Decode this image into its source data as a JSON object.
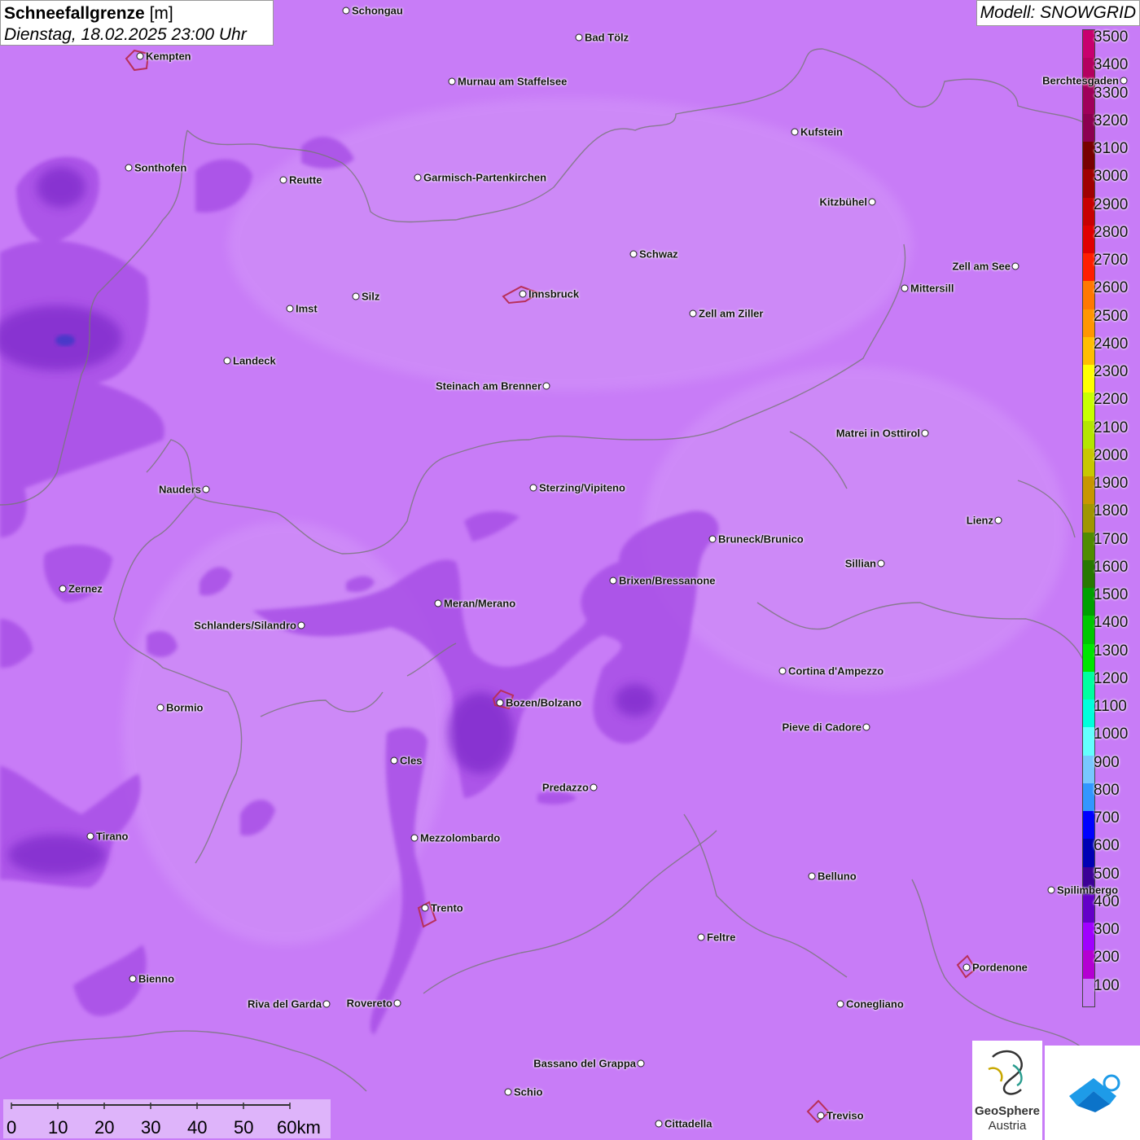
{
  "header": {
    "title_bold": "Schneefallgrenze",
    "title_unit": " [m]",
    "datetime": "Dienstag, 18.02.2025 23:00 Uhr"
  },
  "model_label": "Modell: SNOWGRID",
  "legend": {
    "labels": [
      "3500",
      "3400",
      "3300",
      "3200",
      "3100",
      "3000",
      "2900",
      "2800",
      "2700",
      "2600",
      "2500",
      "2400",
      "2300",
      "2200",
      "2100",
      "2000",
      "1900",
      "1800",
      "1700",
      "1600",
      "1500",
      "1400",
      "1300",
      "1200",
      "1100",
      "1000",
      "900",
      "800",
      "700",
      "600",
      "500",
      "400",
      "300",
      "200",
      "100"
    ],
    "colors": [
      "#c8006e",
      "#b4005f",
      "#a0005a",
      "#8c0050",
      "#780000",
      "#a00000",
      "#c80000",
      "#e00000",
      "#ff1e00",
      "#ff7800",
      "#ff9600",
      "#ffbe00",
      "#ffff00",
      "#c8ff00",
      "#b4e600",
      "#c8c800",
      "#c89600",
      "#a09600",
      "#508c00",
      "#287800",
      "#00a000",
      "#00c800",
      "#00e600",
      "#00ffa0",
      "#00ffdc",
      "#64ffff",
      "#78c8ff",
      "#3296ff",
      "#0000ff",
      "#0000b4",
      "#3c0096",
      "#6400c8",
      "#a000ff",
      "#b400d2",
      "#c87cf7"
    ]
  },
  "cities": [
    {
      "name": "Schongau",
      "label_side": "right"
    },
    {
      "name": "Bad Tölz",
      "label_side": "right"
    },
    {
      "name": "Kempten",
      "label_side": "right"
    },
    {
      "name": "Murnau am Staffelsee",
      "label_side": "right"
    },
    {
      "name": "Berchtesgaden",
      "label_side": "left"
    },
    {
      "name": "Kufstein",
      "label_side": "right"
    },
    {
      "name": "Sonthofen",
      "label_side": "right"
    },
    {
      "name": "Reutte",
      "label_side": "right"
    },
    {
      "name": "Garmisch-Partenkirchen",
      "label_side": "right"
    },
    {
      "name": "Kitzbühel",
      "label_side": "left"
    },
    {
      "name": "Schwaz",
      "label_side": "right"
    },
    {
      "name": "Zell am See",
      "label_side": "left"
    },
    {
      "name": "Mittersill",
      "label_side": "right"
    },
    {
      "name": "Innsbruck",
      "label_side": "right"
    },
    {
      "name": "Silz",
      "label_side": "right"
    },
    {
      "name": "Imst",
      "label_side": "right"
    },
    {
      "name": "Zell am Ziller",
      "label_side": "right"
    },
    {
      "name": "Landeck",
      "label_side": "right"
    },
    {
      "name": "Steinach am Brenner",
      "label_side": "left"
    },
    {
      "name": "Matrei in Osttirol",
      "label_side": "left"
    },
    {
      "name": "Nauders",
      "label_side": "left"
    },
    {
      "name": "Sterzing/Vipiteno",
      "label_side": "right"
    },
    {
      "name": "Lienz",
      "label_side": "left"
    },
    {
      "name": "Bruneck/Brunico",
      "label_side": "right"
    },
    {
      "name": "Sillian",
      "label_side": "left"
    },
    {
      "name": "Zernez",
      "label_side": "right"
    },
    {
      "name": "Brixen/Bressanone",
      "label_side": "right"
    },
    {
      "name": "Meran/Merano",
      "label_side": "right"
    },
    {
      "name": "Schlanders/Silandro",
      "label_side": "left"
    },
    {
      "name": "Cortina d'Ampezzo",
      "label_side": "right"
    },
    {
      "name": "Bozen/Bolzano",
      "label_side": "right"
    },
    {
      "name": "Bormio",
      "label_side": "right"
    },
    {
      "name": "Pieve di Cadore",
      "label_side": "left"
    },
    {
      "name": "Cles",
      "label_side": "right"
    },
    {
      "name": "Predazzo",
      "label_side": "left"
    },
    {
      "name": "Tirano",
      "label_side": "right"
    },
    {
      "name": "Mezzolombardo",
      "label_side": "right"
    },
    {
      "name": "Belluno",
      "label_side": "right"
    },
    {
      "name": "Spilimbergo",
      "label_side": "right"
    },
    {
      "name": "Trento",
      "label_side": "right"
    },
    {
      "name": "Feltre",
      "label_side": "right"
    },
    {
      "name": "Pordenone",
      "label_side": "right"
    },
    {
      "name": "Bienno",
      "label_side": "right"
    },
    {
      "name": "Riva del Garda",
      "label_side": "left"
    },
    {
      "name": "Rovereto",
      "label_side": "left"
    },
    {
      "name": "Conegliano",
      "label_side": "right"
    },
    {
      "name": "Bassano del Grappa",
      "label_side": "left"
    },
    {
      "name": "Schio",
      "label_side": "right"
    },
    {
      "name": "Treviso",
      "label_side": "right"
    },
    {
      "name": "Cittadella",
      "label_side": "right"
    }
  ],
  "scale": {
    "labels": [
      "0",
      "10",
      "20",
      "30",
      "40",
      "50",
      "60km"
    ]
  },
  "logo": {
    "line1": "GeoSphere",
    "line2": "Austria"
  }
}
